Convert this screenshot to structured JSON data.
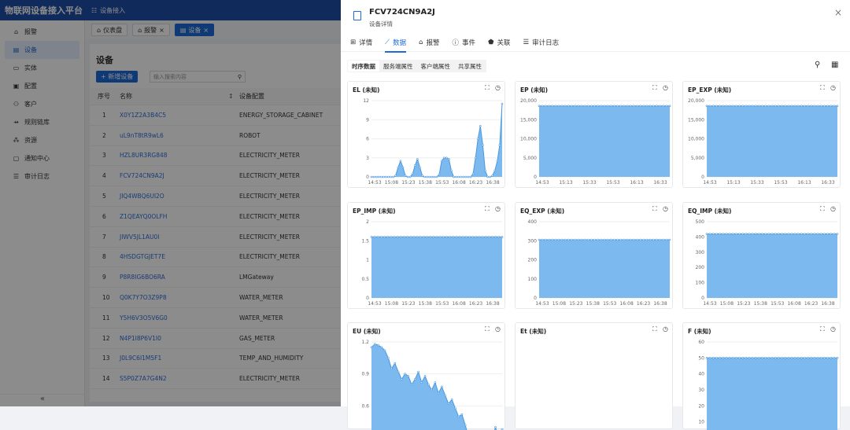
{
  "app": {
    "title": "物联网设备接入平台",
    "nav_label": "设备接入"
  },
  "sidebar": {
    "items": [
      {
        "label": "报警",
        "icon": "bell-icon",
        "glyph": "⌂"
      },
      {
        "label": "设备",
        "icon": "device-icon",
        "glyph": "▤",
        "active": true
      },
      {
        "label": "实体",
        "icon": "monitor-icon",
        "glyph": "▭"
      },
      {
        "label": "配置",
        "icon": "config-icon",
        "glyph": "▣"
      },
      {
        "label": "客户",
        "icon": "users-icon",
        "glyph": "⚇"
      },
      {
        "label": "规则链库",
        "icon": "rule-chain-icon",
        "glyph": "⇸"
      },
      {
        "label": "资源",
        "icon": "resource-icon",
        "glyph": "⁂"
      },
      {
        "label": "通知中心",
        "icon": "notification-icon",
        "glyph": "▢"
      },
      {
        "label": "审计日志",
        "icon": "audit-log-icon",
        "glyph": "☰"
      }
    ],
    "collapse_label": "«"
  },
  "page_tabs": [
    {
      "label": "仪表盘",
      "icon": "home-icon",
      "glyph": "⌂",
      "closable": false
    },
    {
      "label": "报警",
      "icon": "bell-icon",
      "glyph": "⌂",
      "closable": true
    },
    {
      "label": "设备",
      "icon": "device-icon",
      "glyph": "▤",
      "closable": true,
      "active": true
    }
  ],
  "devices": {
    "title": "设备",
    "add_button": "+ 新增设备",
    "search_placeholder": "输入搜索内容",
    "columns": {
      "index": "序号",
      "name": "名称",
      "profile": "设备配置"
    },
    "rows": [
      {
        "index": "1",
        "name": "X0Y1Z2A3B4C5",
        "profile": "ENERGY_STORAGE_CABINET"
      },
      {
        "index": "2",
        "name": "uL9nT8tR9wL6",
        "profile": "ROBOT"
      },
      {
        "index": "3",
        "name": "HZL8UR3RG848",
        "profile": "ELECTRICITY_METER"
      },
      {
        "index": "4",
        "name": "FCV724CN9A2J",
        "profile": "ELECTRICITY_METER"
      },
      {
        "index": "5",
        "name": "JIQ4WBQ6UI2O",
        "profile": "ELECTRICITY_METER"
      },
      {
        "index": "6",
        "name": "Z1QEAYQ0OLFH",
        "profile": "ELECTRICITY_METER"
      },
      {
        "index": "7",
        "name": "JIWV5JL1AU0I",
        "profile": "ELECTRICITY_METER"
      },
      {
        "index": "8",
        "name": "4HSDGTGJET7E",
        "profile": "ELECTRICITY_METER"
      },
      {
        "index": "9",
        "name": "P8R8IG6BO6RA",
        "profile": "LMGateway"
      },
      {
        "index": "10",
        "name": "Q0K7Y7O3Z9P8",
        "profile": "WATER_METER"
      },
      {
        "index": "11",
        "name": "Y5H6V3O5V6G0",
        "profile": "WATER_METER"
      },
      {
        "index": "12",
        "name": "N4P1I8P6V1I0",
        "profile": "GAS_METER"
      },
      {
        "index": "13",
        "name": "J0L9C6I1M5F1",
        "profile": "TEMP_AND_HUMIDITY"
      },
      {
        "index": "14",
        "name": "S5P0Z7A7G4N2",
        "profile": "ELECTRICITY_METER"
      }
    ]
  },
  "drawer": {
    "title": "FCV724CN9A2J",
    "subtitle": "设备详情",
    "close": "×",
    "tabs": [
      {
        "label": "详情",
        "icon": "details-icon",
        "glyph": "⊞"
      },
      {
        "label": "数据",
        "icon": "chart-icon",
        "glyph": "⟋",
        "active": true
      },
      {
        "label": "报警",
        "icon": "bell-icon",
        "glyph": "⌂"
      },
      {
        "label": "事件",
        "icon": "info-icon",
        "glyph": "ⓘ"
      },
      {
        "label": "关联",
        "icon": "relation-icon",
        "glyph": "⬟"
      },
      {
        "label": "审计日志",
        "icon": "list-icon",
        "glyph": "☰"
      }
    ],
    "sub_tabs": [
      {
        "label": "时序数据",
        "active": true
      },
      {
        "label": "服务端属性"
      },
      {
        "label": "客户端属性"
      },
      {
        "label": "共享属性"
      }
    ]
  },
  "chart_data": [
    {
      "type": "area",
      "title": "EL (未知)",
      "x": [
        "14:53",
        "15:08",
        "15:23",
        "15:38",
        "15:53",
        "16:08",
        "16:23",
        "16:38"
      ],
      "ylim": [
        0,
        12
      ],
      "yticks": [
        0,
        3,
        6,
        9,
        12
      ],
      "values": [
        0,
        0,
        0,
        0,
        0,
        0,
        0,
        0,
        0,
        0,
        0.2,
        1.5,
        2.5,
        1.5,
        0.2,
        0,
        0,
        0.5,
        1.8,
        2.8,
        1.5,
        0.2,
        0,
        0,
        0,
        0,
        0,
        0,
        0.4,
        2.5,
        3,
        3,
        2.8,
        1,
        0,
        0,
        0,
        0,
        0,
        0,
        0,
        0,
        0.5,
        3,
        6,
        8,
        5,
        1,
        0,
        0,
        0.2,
        1,
        2.5,
        5,
        11.5
      ]
    },
    {
      "type": "area",
      "title": "EP (未知)",
      "x": [
        "14:53",
        "15:13",
        "15:33",
        "15:53",
        "16:13",
        "16:33"
      ],
      "ylim": [
        0,
        20000
      ],
      "yticks": [
        0,
        5000,
        10000,
        15000,
        20000
      ],
      "values": [
        18600,
        18600,
        18600,
        18600,
        18600,
        18600,
        18600,
        18600,
        18600,
        18600,
        18600,
        18600,
        18600,
        18600,
        18600,
        18600,
        18600,
        18600,
        18600,
        18600,
        18600,
        18600,
        18600,
        18600,
        18600,
        18600,
        18600,
        18600,
        18600,
        18600,
        18600,
        18600,
        18600,
        18600,
        18600,
        18600,
        18600,
        18600,
        18600,
        18600,
        18600
      ]
    },
    {
      "type": "area",
      "title": "EP_EXP (未知)",
      "x": [
        "14:53",
        "15:13",
        "15:33",
        "15:53",
        "16:13",
        "16:33"
      ],
      "ylim": [
        0,
        20000
      ],
      "yticks": [
        0,
        5000,
        10000,
        15000,
        20000
      ],
      "values": [
        18600,
        18600,
        18600,
        18600,
        18600,
        18600,
        18600,
        18600,
        18600,
        18600,
        18600,
        18600,
        18600,
        18600,
        18600,
        18600,
        18600,
        18600,
        18600,
        18600,
        18600,
        18600,
        18600,
        18600,
        18600,
        18600,
        18600,
        18600,
        18600,
        18600,
        18600,
        18600,
        18600,
        18600,
        18600,
        18600,
        18600,
        18600,
        18600,
        18600,
        18600
      ]
    },
    {
      "type": "area",
      "title": "EP_IMP (未知)",
      "x": [
        "14:53",
        "15:08",
        "15:23",
        "15:38",
        "15:53",
        "16:08",
        "16:23",
        "16:38"
      ],
      "ylim": [
        0,
        2
      ],
      "yticks": [
        0,
        0.5,
        1,
        1.5,
        2
      ],
      "values": [
        1.6,
        1.6,
        1.6,
        1.6,
        1.6,
        1.6,
        1.6,
        1.6,
        1.6,
        1.6,
        1.6,
        1.6,
        1.6,
        1.6,
        1.6,
        1.6,
        1.6,
        1.6,
        1.6,
        1.6,
        1.6,
        1.6,
        1.6,
        1.6,
        1.6,
        1.6,
        1.6,
        1.6,
        1.6,
        1.6,
        1.6,
        1.6,
        1.6,
        1.6,
        1.6,
        1.6,
        1.6,
        1.6,
        1.6,
        1.6,
        1.6
      ]
    },
    {
      "type": "area",
      "title": "EQ_EXP (未知)",
      "x": [
        "14:53",
        "15:08",
        "15:23",
        "15:38",
        "15:53",
        "16:08",
        "16:23",
        "16:38"
      ],
      "ylim": [
        0,
        400
      ],
      "yticks": [
        0,
        100,
        200,
        300,
        400
      ],
      "values": [
        305,
        305,
        305,
        305,
        305,
        305,
        305,
        305,
        305,
        305,
        305,
        305,
        305,
        305,
        305,
        305,
        305,
        305,
        305,
        305,
        305,
        305,
        305,
        305,
        305,
        305,
        305,
        305,
        305,
        305,
        305,
        305,
        305,
        305,
        305,
        305,
        305,
        305,
        305,
        305,
        305
      ]
    },
    {
      "type": "area",
      "title": "EQ_IMP (未知)",
      "x": [
        "14:53",
        "15:08",
        "15:23",
        "15:38",
        "15:53",
        "16:08",
        "16:23",
        "16:38"
      ],
      "ylim": [
        0,
        500
      ],
      "yticks": [
        0,
        100,
        200,
        300,
        400,
        500
      ],
      "values": [
        420,
        420,
        420,
        420,
        420,
        420,
        420,
        420,
        420,
        420,
        420,
        420,
        420,
        420,
        420,
        420,
        420,
        420,
        420,
        420,
        420,
        420,
        420,
        420,
        420,
        420,
        420,
        420,
        420,
        420,
        420,
        420,
        420,
        420,
        420,
        420,
        420,
        420,
        420,
        420,
        420
      ]
    },
    {
      "type": "area",
      "title": "EU (未知)",
      "x": [],
      "ylim": [
        0.3,
        1.2
      ],
      "yticks": [
        0.3,
        0.6,
        0.9,
        1.2
      ],
      "values": [
        1.15,
        1.18,
        1.17,
        1.15,
        1.12,
        1.05,
        0.95,
        1.0,
        0.92,
        0.85,
        0.9,
        0.88,
        0.8,
        0.85,
        0.92,
        0.82,
        0.88,
        0.8,
        0.75,
        0.82,
        0.72,
        0.78,
        0.7,
        0.62,
        0.66,
        0.58,
        0.5,
        0.52,
        0.42,
        0.3,
        0.25,
        0.28,
        0.22,
        0.3,
        0.26,
        0.35,
        0.28,
        0.4,
        0.3,
        0.38
      ]
    },
    {
      "type": "area",
      "title": "Et (未知)",
      "x": [],
      "ylim": null,
      "yticks": [],
      "values": []
    },
    {
      "type": "area",
      "title": "F (未知)",
      "x": [],
      "ylim": [
        0,
        60
      ],
      "yticks": [
        10,
        20,
        30,
        40,
        50,
        60
      ],
      "values": [
        50,
        50,
        50,
        50,
        50,
        50,
        50,
        50,
        50,
        50,
        50,
        50,
        50,
        50,
        50,
        50,
        50,
        50,
        50,
        50,
        50,
        50,
        50,
        50,
        50,
        50,
        50,
        50,
        50,
        50,
        50,
        50,
        50,
        50,
        50,
        50,
        50,
        50,
        50,
        50,
        50
      ]
    }
  ],
  "colors": {
    "primary": "#1e6ad6",
    "area_fill": "#7cb9ee",
    "area_line": "#4a98e0",
    "header": "#1e4fa6"
  },
  "icons": {
    "expand": "expand-icon",
    "history": "history-icon",
    "search": "search-icon",
    "columns": "columns-icon"
  }
}
